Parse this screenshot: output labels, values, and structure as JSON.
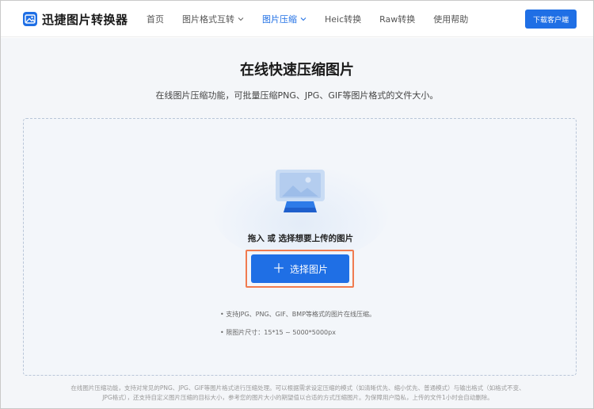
{
  "header": {
    "logo_text": "迅捷图片转换器",
    "nav": [
      {
        "label": "首页",
        "dropdown": false,
        "active": false
      },
      {
        "label": "图片格式互转",
        "dropdown": true,
        "active": false
      },
      {
        "label": "图片压缩",
        "dropdown": true,
        "active": true
      },
      {
        "label": "Heic转换",
        "dropdown": false,
        "active": false
      },
      {
        "label": "Raw转换",
        "dropdown": false,
        "active": false
      },
      {
        "label": "使用帮助",
        "dropdown": false,
        "active": false
      }
    ],
    "download_label": "下载客户端"
  },
  "main": {
    "title": "在线快速压缩图片",
    "subtitle": "在线图片压缩功能，可批量压缩PNG、JPG、GIF等图片格式的文件大小。",
    "drop_text": "拖入 或 选择想要上传的图片",
    "select_button": "选择图片",
    "tips": [
      "• 支持JPG、PNG、GIF、BMP等格式的图片在线压缩。",
      "• 限图片尺寸：15*15 ~ 5000*5000px"
    ]
  },
  "footer": {
    "line1": "在线图片压缩功能，支持对常见的PNG、JPG、GIF等图片格式进行压缩处理。可以根据需求设定压缩的模式（如清晰优先、缩小优先、普通模式）与输出格式（如格式不变、",
    "line2": "JPG格式），还支持自定义图片压缩的目标大小，参考您的图片大小的期望值以合适的方式压缩图片。为保障用户隐私，上传的文件1小时会自动删除。"
  },
  "colors": {
    "accent": "#1f6fe5",
    "highlight_border": "#f07b4f"
  }
}
